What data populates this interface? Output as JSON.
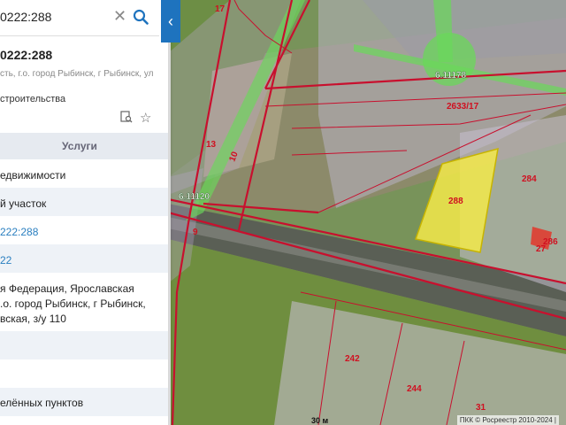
{
  "search": {
    "value": "0222:288"
  },
  "object": {
    "title": "0222:288",
    "address_short": "сть, г.о. город Рыбинск, г Рыбинск, ул",
    "category": "строительства"
  },
  "tabs": {
    "services_label": "Услуги"
  },
  "rows": [
    {
      "text": "едвижимости",
      "link": false
    },
    {
      "text": "й участок",
      "link": false
    },
    {
      "text": "222:288",
      "link": true
    },
    {
      "text": "22",
      "link": true
    },
    {
      "text_lines": [
        "я Федерация, Ярославская",
        ".о. город Рыбинск, г Рыбинск,",
        "вская, з/у 110"
      ]
    },
    {
      "text": "елённых пунктов",
      "link": false
    }
  ],
  "map": {
    "parcel_labels": [
      "17",
      "6.11178",
      "2633/17",
      "284",
      "288",
      "13",
      "10",
      "6.11120",
      "9",
      "27",
      "286",
      "242",
      "244",
      "31"
    ],
    "scale_label": "30 м",
    "credit": "ПКК © Росреестр 2010-2024 | "
  },
  "colors": {
    "accent": "#1e73be",
    "highlight": "#f3e94a",
    "boundary": "#c8102e"
  }
}
